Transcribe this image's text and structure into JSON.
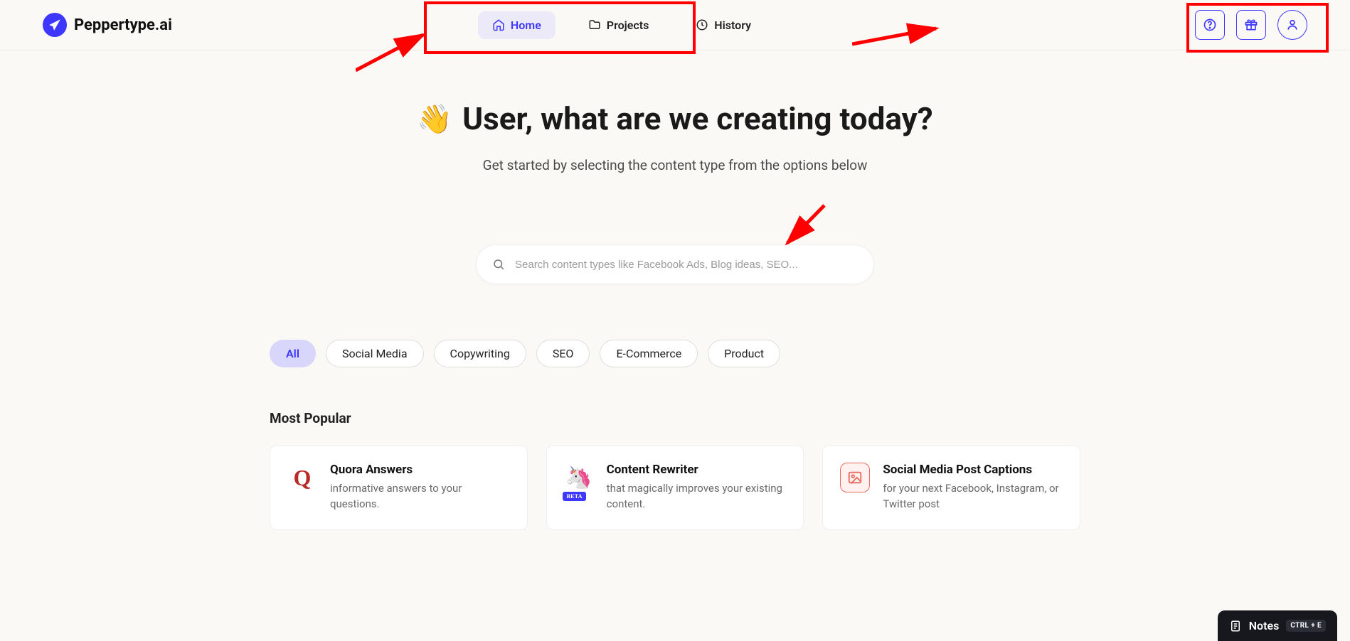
{
  "brand": {
    "name": "Peppertype.ai"
  },
  "nav": {
    "items": [
      {
        "label": "Home",
        "active": true
      },
      {
        "label": "Projects",
        "active": false
      },
      {
        "label": "History",
        "active": false
      }
    ]
  },
  "header_icons": {
    "help": "help-circle-icon",
    "gift": "gift-icon",
    "user": "user-icon"
  },
  "hero": {
    "wave_emoji": "👋",
    "title": "User, what are we creating today?",
    "subtitle": "Get started by selecting the content type from the options below"
  },
  "search": {
    "placeholder": "Search content types like Facebook Ads, Blog ideas, SEO...",
    "value": ""
  },
  "chips": [
    {
      "label": "All",
      "active": true
    },
    {
      "label": "Social Media",
      "active": false
    },
    {
      "label": "Copywriting",
      "active": false
    },
    {
      "label": "SEO",
      "active": false
    },
    {
      "label": "E-Commerce",
      "active": false
    },
    {
      "label": "Product",
      "active": false
    }
  ],
  "section": {
    "most_popular": "Most Popular"
  },
  "cards": [
    {
      "icon": "quora",
      "title": "Quora Answers",
      "desc": "informative answers to your questions."
    },
    {
      "icon": "unicorn",
      "badge": "BETA",
      "title": "Content Rewriter",
      "desc": "that magically improves your existing content."
    },
    {
      "icon": "image",
      "title": "Social Media Post Captions",
      "desc": "for your next Facebook, Instagram, or Twitter post"
    }
  ],
  "notes": {
    "label": "Notes",
    "shortcut": "CTRL + E"
  },
  "annotations": {
    "box_nav": true,
    "box_actions": true,
    "arrow_nav": true,
    "arrow_actions": true,
    "arrow_search": true
  }
}
